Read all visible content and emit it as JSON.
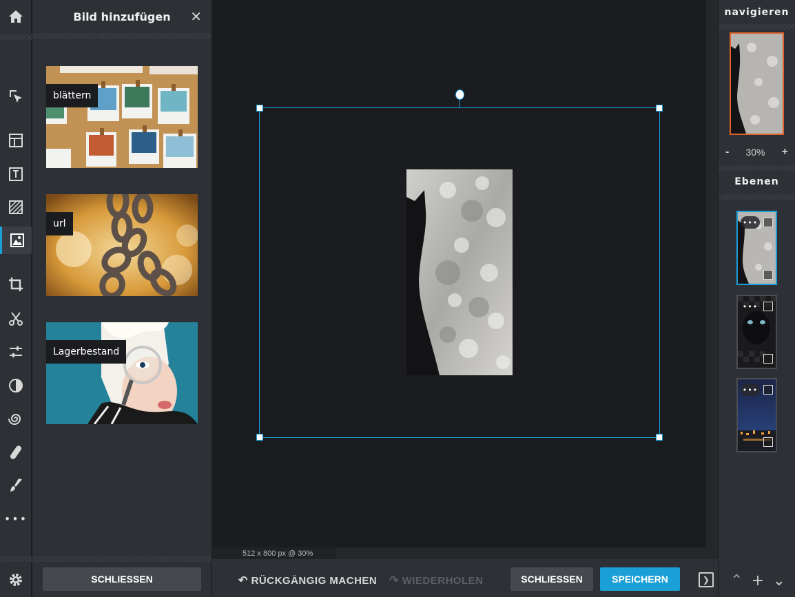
{
  "panel": {
    "title": "Bild hinzufügen",
    "close_symbol": "✕",
    "sources": [
      {
        "label": "blättern"
      },
      {
        "label": "url"
      },
      {
        "label": "Lagerbestand"
      }
    ],
    "close_button": "SCHLIESSEN"
  },
  "toolbar": {
    "icons": [
      "home-icon",
      "select-icon",
      "layout-icon",
      "text-icon",
      "texture-icon",
      "image-icon",
      "crop-icon",
      "cut-icon",
      "adjust-icon",
      "contrast-icon",
      "spiral-icon",
      "bandage-icon",
      "brush-icon",
      "more-icon",
      "settings-icon"
    ],
    "more": "•••"
  },
  "canvas": {
    "status": "512 x 800 px @ 30%"
  },
  "bottombar": {
    "undo": "RÜCKGÄNGIG MACHEN",
    "redo": "WIEDERHOLEN",
    "close": "SCHLIESSEN",
    "save": "SPEICHERN"
  },
  "right": {
    "nav_title": "navigieren",
    "zoom_minus": "-",
    "zoom_value": "30%",
    "zoom_plus": "+",
    "layers_title": "Ebenen",
    "layer_dots": "•••",
    "layer_count": 3
  },
  "colors": {
    "accent": "#1a9fd7",
    "nav_border": "#e0622b",
    "panel_bg": "#2d3034",
    "canvas_bg": "#1b1c1f"
  }
}
